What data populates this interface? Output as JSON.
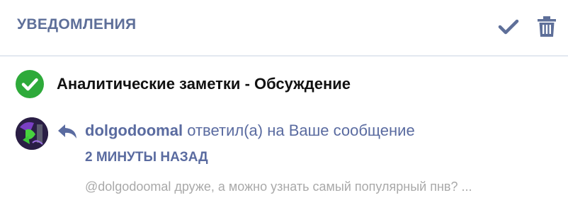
{
  "header": {
    "title": "УВЕДОМЛЕНИЯ",
    "mark_read_icon": "check-icon",
    "delete_icon": "trash-icon"
  },
  "group": {
    "status_icon": "check-circle-icon",
    "title": "Аналитические заметки - Обсуждение"
  },
  "notification": {
    "avatar": "user-avatar",
    "type_icon": "reply-icon",
    "username": "dolgodoomal",
    "action": "ответил(а) на Ваше сообщение",
    "time": "2 МИНУТЫ НАЗАД",
    "excerpt": "@dolgodoomal друже, а можно узнать самый популярный пнв? ..."
  },
  "colors": {
    "accent": "#5a6ba0",
    "success": "#2eaa3a",
    "muted_text": "#a9a9a9",
    "divider": "#e3e8f0"
  }
}
